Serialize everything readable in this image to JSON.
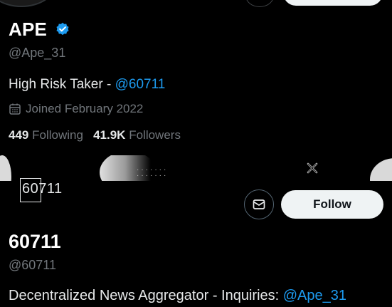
{
  "profile1": {
    "name": "APE",
    "handle": "@Ape_31",
    "bio_text": "High Risk Taker - ",
    "bio_link": "@60711",
    "joined": "Joined February 2022",
    "following_count": "449",
    "following_label": "Following",
    "followers_count": "41.9K",
    "followers_label": "Followers"
  },
  "profile2": {
    "logo_text": "60711",
    "follow_label": "Follow",
    "name": "60711",
    "handle": "@60711",
    "bio_text": "Decentralized News Aggregator - Inquiries: ",
    "bio_link": "@Ape_31"
  },
  "icons": {
    "verified": "verified-badge-icon",
    "calendar": "calendar-icon",
    "mail": "mail-icon",
    "banner_x": "x-mark-icon"
  },
  "colors": {
    "background": "#000000",
    "text_primary": "#e7e9ea",
    "text_secondary": "#71767b",
    "link": "#1d9bf0",
    "button_bg": "#eff3f4"
  }
}
